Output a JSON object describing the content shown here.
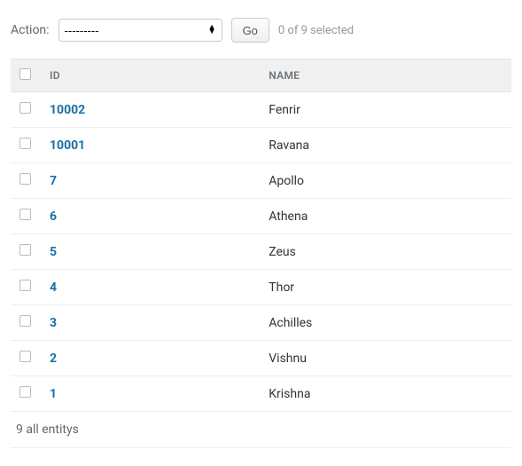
{
  "action": {
    "label": "Action:",
    "selected": "---------",
    "go_label": "Go",
    "selected_count_text": "0 of 9 selected"
  },
  "table": {
    "headers": {
      "id": "ID",
      "name": "NAME"
    },
    "rows": [
      {
        "id": "10002",
        "name": "Fenrir"
      },
      {
        "id": "10001",
        "name": "Ravana"
      },
      {
        "id": "7",
        "name": "Apollo"
      },
      {
        "id": "6",
        "name": "Athena"
      },
      {
        "id": "5",
        "name": "Zeus"
      },
      {
        "id": "4",
        "name": "Thor"
      },
      {
        "id": "3",
        "name": "Achilles"
      },
      {
        "id": "2",
        "name": "Vishnu"
      },
      {
        "id": "1",
        "name": "Krishna"
      }
    ]
  },
  "footer": {
    "text": "9 all entitys"
  }
}
